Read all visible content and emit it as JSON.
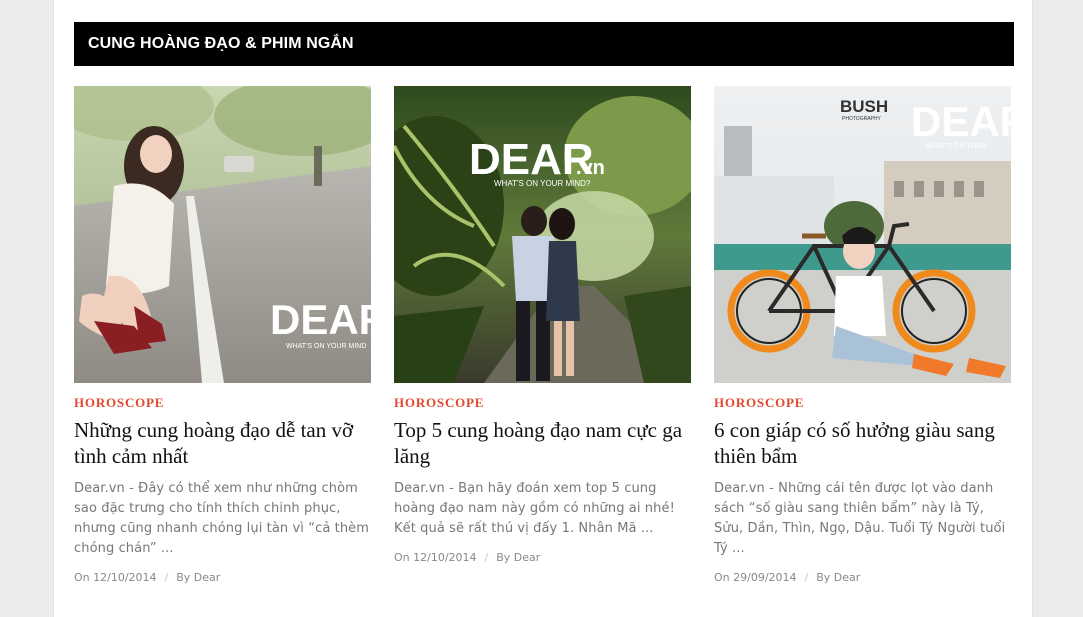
{
  "section": {
    "title": "CUNG HOÀNG ĐẠO & PHIM NGẮN"
  },
  "posts": [
    {
      "category": "HOROSCOPE",
      "title": "Những cung hoàng đạo dễ tan vỡ tình cảm nhất",
      "excerpt": "Dear.vn - Đây có thể xem như những chòm sao đặc trưng cho tính thích chinh phục, nhưng cũng nhanh chóng lụi tàn vì “cả thèm chóng chán” ...",
      "date": "On 12/10/2014",
      "author": "By Dear",
      "watermark": "DEAR",
      "watermark_sub": "WHAT'S ON YOUR MIND"
    },
    {
      "category": "HOROSCOPE",
      "title": "Top 5 cung hoàng đạo nam cực ga lăng",
      "excerpt": "Dear.vn - Bạn hãy đoán xem top 5 cung hoàng đạo nam này gồm có những ai nhé! Kết quả sẽ rất thú vị đấy 1. Nhân Mã ...",
      "date": "On 12/10/2014",
      "author": "By Dear",
      "watermark": "DEAR",
      "watermark_suffix": ".vn",
      "watermark_sub": "WHAT'S ON YOUR MIND?"
    },
    {
      "category": "HOROSCOPE",
      "title": "6 con giáp có số hưởng giàu sang thiên bẩm",
      "excerpt": "Dear.vn - Những cái tên được lọt vào danh sách “số giàu sang thiên bẩm” này là Tý, Sửu, Dần, Thìn, Ngọ, Dậu. Tuổi Tý Người tuổi Tý ...",
      "date": "On 29/09/2014",
      "author": "By Dear",
      "watermark": "DEAR",
      "watermark_sub": "WHAT'S ON YOUR",
      "brand": "BUSH",
      "brand_sub": "PHOTOGRAPHY"
    }
  ],
  "colors": {
    "accent": "#e2482e",
    "header_bg": "#000000",
    "title_text": "#111111",
    "excerpt_text": "#777777",
    "meta_text": "#888888"
  }
}
